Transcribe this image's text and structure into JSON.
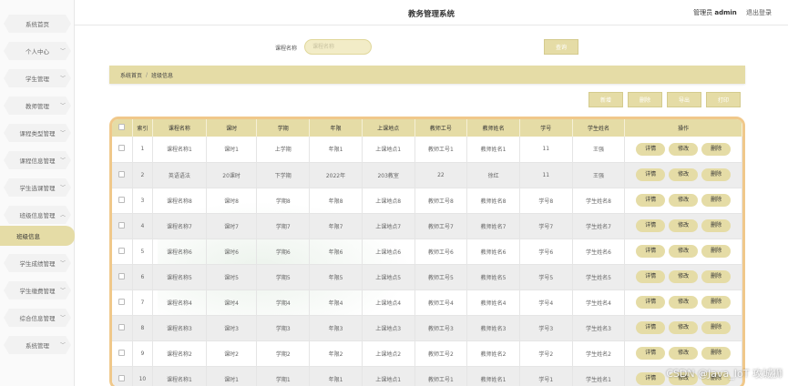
{
  "header": {
    "title": "教务管理系统",
    "user_label": "管理员",
    "username": "admin",
    "logout": "退出登录"
  },
  "sidebar": {
    "items": [
      {
        "label": "系统首页",
        "has_chevron": false
      },
      {
        "label": "个人中心",
        "has_chevron": true
      },
      {
        "label": "学生管理",
        "has_chevron": true
      },
      {
        "label": "教师管理",
        "has_chevron": true
      },
      {
        "label": "课程类型管理",
        "has_chevron": true
      },
      {
        "label": "课程信息管理",
        "has_chevron": true
      },
      {
        "label": "学生选课管理",
        "has_chevron": true
      },
      {
        "label": "班级信息管理",
        "has_chevron": true,
        "expanded": true
      },
      {
        "label": "学生成绩管理",
        "has_chevron": true
      },
      {
        "label": "学生缴费管理",
        "has_chevron": true
      },
      {
        "label": "综合信息管理",
        "has_chevron": true
      },
      {
        "label": "系统管理",
        "has_chevron": true
      }
    ],
    "active_sub": "班级信息"
  },
  "search": {
    "label": "课程名称",
    "placeholder": "课程名称",
    "button": "查询"
  },
  "breadcrumb": {
    "home": "系统首页",
    "separator": "/",
    "current": "班级信息"
  },
  "actions": {
    "add": "新增",
    "delete": "删除",
    "export": "导出",
    "print": "打印"
  },
  "table": {
    "columns": [
      "索引",
      "课程名称",
      "课时",
      "学期",
      "年限",
      "上课地点",
      "教师工号",
      "教师姓名",
      "学号",
      "学生姓名",
      "操作"
    ],
    "row_buttons": {
      "detail": "详情",
      "edit": "修改",
      "delete": "删除"
    },
    "rows": [
      [
        "1",
        "课程名称1",
        "课时1",
        "上学期",
        "年限1",
        "上课地点1",
        "教师工号1",
        "教师姓名1",
        "11",
        "王强"
      ],
      [
        "2",
        "英语语法",
        "20课时",
        "下学期",
        "2022年",
        "203教室",
        "22",
        "徐红",
        "11",
        "王强"
      ],
      [
        "3",
        "课程名称8",
        "课时8",
        "学期8",
        "年限8",
        "上课地点8",
        "教师工号8",
        "教师姓名8",
        "学号8",
        "学生姓名8"
      ],
      [
        "4",
        "课程名称7",
        "课时7",
        "学期7",
        "年限7",
        "上课地点7",
        "教师工号7",
        "教师姓名7",
        "学号7",
        "学生姓名7"
      ],
      [
        "5",
        "课程名称6",
        "课时6",
        "学期6",
        "年限6",
        "上课地点6",
        "教师工号6",
        "教师姓名6",
        "学号6",
        "学生姓名6"
      ],
      [
        "6",
        "课程名称5",
        "课时5",
        "学期5",
        "年限5",
        "上课地点5",
        "教师工号5",
        "教师姓名5",
        "学号5",
        "学生姓名5"
      ],
      [
        "7",
        "课程名称4",
        "课时4",
        "学期4",
        "年限4",
        "上课地点4",
        "教师工号4",
        "教师姓名4",
        "学号4",
        "学生姓名4"
      ],
      [
        "8",
        "课程名称3",
        "课时3",
        "学期3",
        "年限3",
        "上课地点3",
        "教师工号3",
        "教师姓名3",
        "学号3",
        "学生姓名3"
      ],
      [
        "9",
        "课程名称2",
        "课时2",
        "学期2",
        "年限2",
        "上课地点2",
        "教师工号2",
        "教师姓名2",
        "学号2",
        "学生姓名2"
      ],
      [
        "10",
        "课程名称1",
        "课时1",
        "学期1",
        "年限1",
        "上课地点1",
        "教师工号1",
        "教师姓名1",
        "学号1",
        "学生姓名1"
      ]
    ]
  },
  "watermark": "CSDN @Java_IoT 攻城狮",
  "colors": {
    "accent": "#e5dca6",
    "table_border": "#f0c88a"
  }
}
